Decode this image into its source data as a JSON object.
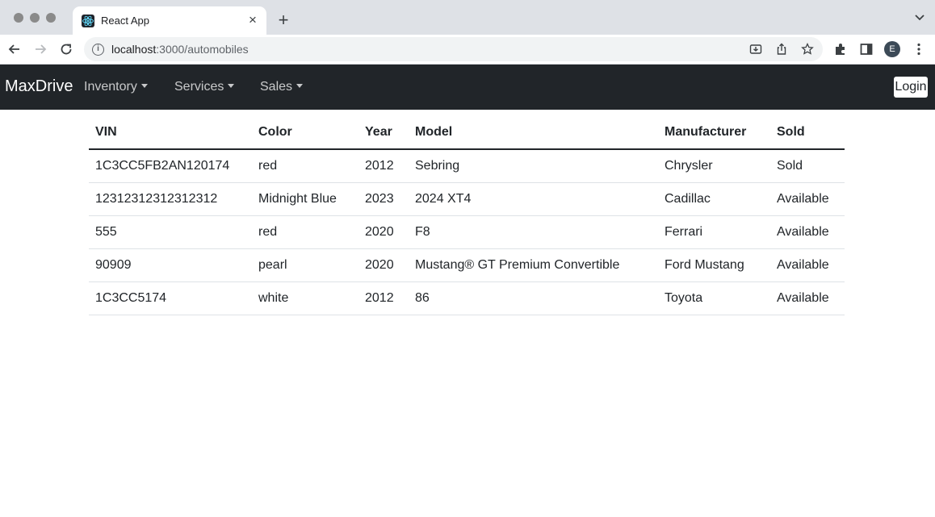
{
  "browser": {
    "tab_title": "React App",
    "new_tab_symbol": "+",
    "tab_close_symbol": "×",
    "url_host": "localhost",
    "url_path": ":3000/automobiles",
    "profile_initial": "E"
  },
  "navbar": {
    "brand": "MaxDrive",
    "items": [
      {
        "label": "Inventory"
      },
      {
        "label": "Services"
      },
      {
        "label": "Sales"
      }
    ],
    "login_label": "Login"
  },
  "table": {
    "headers": [
      "VIN",
      "Color",
      "Year",
      "Model",
      "Manufacturer",
      "Sold"
    ],
    "rows": [
      [
        "1C3CC5FB2AN120174",
        "red",
        "2012",
        "Sebring",
        "Chrysler",
        "Sold"
      ],
      [
        "12312312312312312",
        "Midnight Blue",
        "2023",
        "2024 XT4",
        "Cadillac",
        "Available"
      ],
      [
        "555",
        "red",
        "2020",
        "F8",
        "Ferrari",
        "Available"
      ],
      [
        "90909",
        "pearl",
        "2020",
        "Mustang® GT Premium Convertible",
        "Ford Mustang",
        "Available"
      ],
      [
        "1C3CC5174",
        "white",
        "2012",
        "86",
        "Toyota",
        "Available"
      ]
    ]
  },
  "colors": {
    "navbar_bg": "#212529",
    "tabstrip_bg": "#dee1e6",
    "react_logo": "#61dafb"
  }
}
